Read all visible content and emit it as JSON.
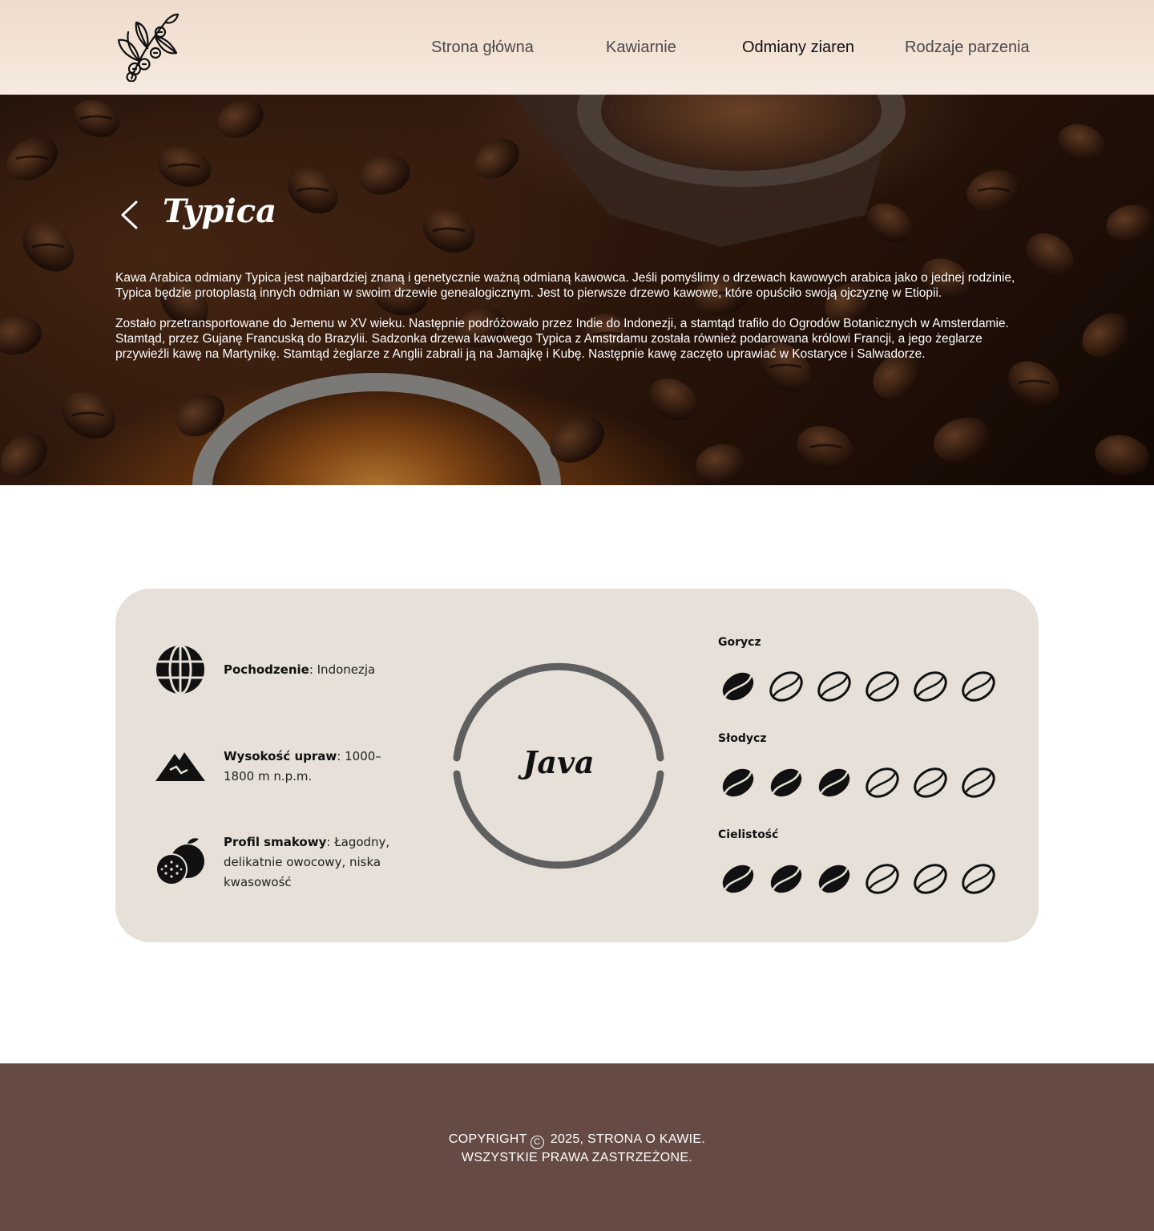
{
  "nav": {
    "items": [
      {
        "label": "Strona główna",
        "active": false
      },
      {
        "label": "Kawiarnie",
        "active": false
      },
      {
        "label": "Odmiany ziaren",
        "active": true
      },
      {
        "label": "Rodzaje parzenia",
        "active": false
      }
    ]
  },
  "hero": {
    "back_icon": "chevron-left-icon",
    "title": "Typica",
    "paragraphs": [
      "Kawa Arabica odmiany Typica jest najbardziej znaną i genetycznie ważną odmianą kawowca. Jeśli pomyślimy o drzewach kawowych arabica jako o jednej rodzinie, Typica będzie protoplastą innych odmian w swoim drzewie genealogicznym. Jest to pierwsze drzewo kawowe, które opuściło swoją ojczyznę w Etiopii.",
      "Zostało przetransportowane do Jemenu w XV wieku. Następnie podróżowało przez Indie do Indonezji, a stamtąd trafiło do Ogrodów Botanicznych w Amsterdamie. Stamtąd, przez Gujanę Francuską do Brazylii. Sadzonka drzewa kawowego Typica z Amstrdamu została również podarowana królowi Francji, a jego żeglarze przywieźli kawę na Martynikę. Stamtąd żeglarze z Anglii zabrali ją na Jamajkę i Kubę. Następnie kawę zaczęto uprawiać w Kostaryce i Salwadorze."
    ]
  },
  "details": {
    "origin": {
      "icon": "globe-icon",
      "label": "Pochodzenie",
      "value": ": Indonezja"
    },
    "altitude": {
      "icon": "mountain-icon",
      "label": "Wysokość upraw",
      "value": ": 1000–1800 m n.p.m."
    },
    "flavor": {
      "icon": "fruit-icon",
      "label": "Profil smakowy",
      "value": ": Łagodny, delikatnie owocowy, niska kwasowość"
    },
    "center_label": "Java"
  },
  "ratings": [
    {
      "label": "Gorycz",
      "value": 1,
      "max": 6
    },
    {
      "label": "Słodycz",
      "value": 3,
      "max": 6
    },
    {
      "label": "Cielistość",
      "value": 3,
      "max": 6
    }
  ],
  "colors": {
    "header_bg": "#efdccc",
    "card_bg": "#e6e0d8",
    "ring": "#5f5f5f",
    "footer_bg": "#654b43"
  },
  "footer": {
    "line1_prefix": "COPYRIGHT",
    "line1_suffix": "2025, STRONA O KAWIE.",
    "line2": "WSZYSTKIE PRAWA ZASTRZEŻONE."
  }
}
